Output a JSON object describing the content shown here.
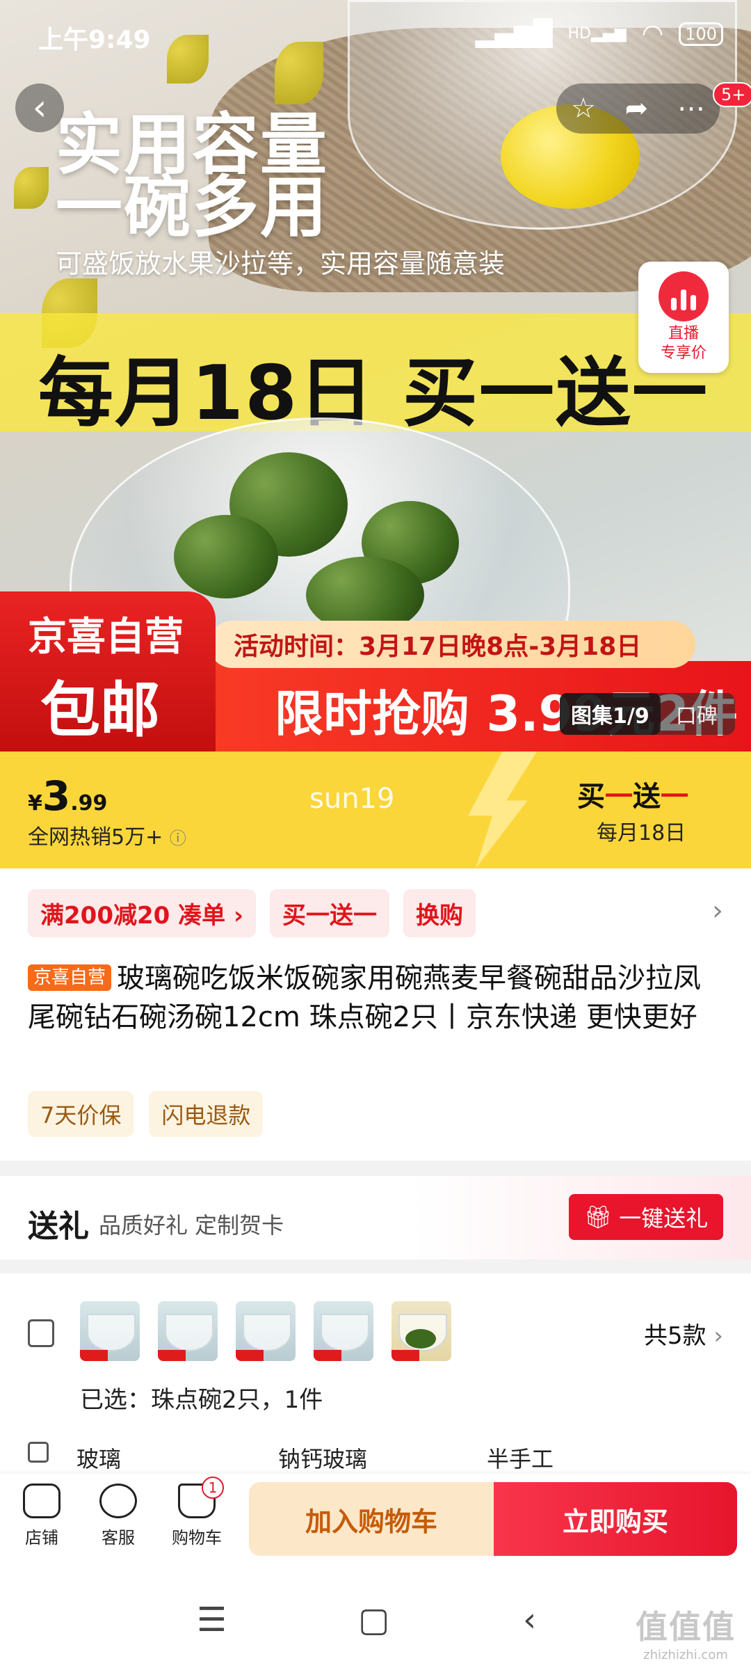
{
  "status_bar": {
    "time": "上午9:49",
    "battery": "100",
    "signal_label": "HD"
  },
  "hero": {
    "headline_1": "实用容量",
    "headline_2": "一碗多用",
    "subheadline": "可盛饭放水果沙拉等，实用容量随意装",
    "band_text": "每月18日 买一送一",
    "activity_time": "活动时间：3月17日晚8点-3月18日",
    "flash_sale": "限时抢购 3.99元2件",
    "jx_self": "京喜自营",
    "jx_shipping": "包邮",
    "gallery_index": "图集1/9",
    "gallery_reviews": "口碑",
    "live_label_1": "直播",
    "live_label_2": "专享价",
    "notify_badge": "5+"
  },
  "price_bar": {
    "currency": "¥",
    "price_int": "3",
    "price_dec": ".99",
    "hot_sales": "全网热销5万+",
    "watermark": "sun19",
    "bogo_a": "买",
    "bogo_b": "一",
    "bogo_c": "送",
    "bogo_d": "一",
    "bogo_date": "每月18日"
  },
  "promotions": [
    "满200减20  凑单 ›",
    "买一送一",
    "换购"
  ],
  "product": {
    "tag": "京喜自营",
    "title": "玻璃碗吃饭米饭碗家用碗燕麦早餐碗甜品沙拉凤尾碗钻石碗汤碗12cm 珠点碗2只丨京东快递 更快更好"
  },
  "services": [
    "7天价保",
    "闪电退款"
  ],
  "gift": {
    "title": "送礼",
    "subtitle": "品质好礼 定制贺卡",
    "button": "一键送礼"
  },
  "variants": {
    "count": "共5款",
    "selected": "已选：珠点碗2只，1件",
    "specs": [
      "玻璃",
      "钠钙玻璃",
      "半手工"
    ]
  },
  "action_bar": {
    "store": "店铺",
    "service": "客服",
    "cart": "购物车",
    "cart_count": "1",
    "add_cart": "加入购物车",
    "buy_now": "立即购买"
  },
  "site_mark": {
    "logo": "值值值",
    "domain": "zhizhizhi.com"
  },
  "colors": {
    "brand_red": "#e8152d",
    "price_yellow": "#fbd63a",
    "jx_orange": "#f76a18"
  }
}
